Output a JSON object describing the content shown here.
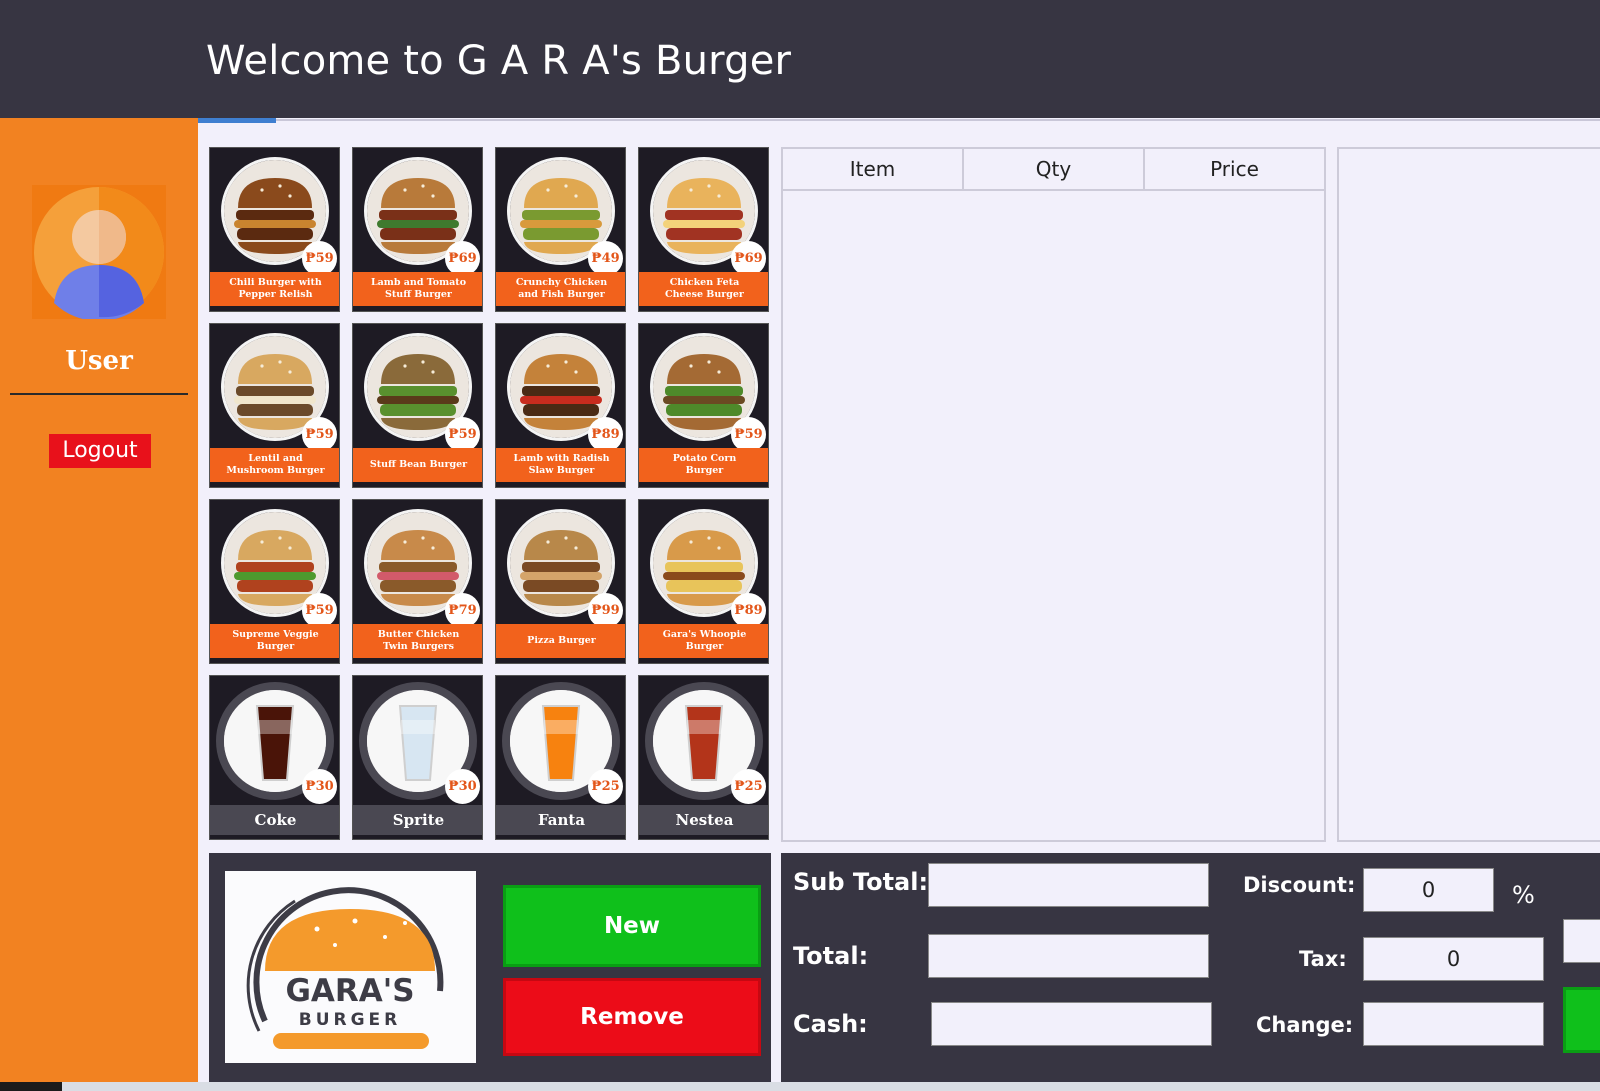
{
  "header": {
    "title": "Welcome to G A R A's Burger"
  },
  "sidebar": {
    "username": "User",
    "logout_label": "Logout"
  },
  "colors": {
    "header_bg": "#373542",
    "sidebar_bg": "#f28221",
    "label_orange": "#f2621c",
    "price_text": "#e3561a",
    "new_green": "#0fc01b",
    "remove_red": "#ec0c18",
    "logout_red": "#e8111b"
  },
  "menu": {
    "items": [
      {
        "name": "Chili Burger with Pepper Relish",
        "price": "₱59",
        "kind": "burger"
      },
      {
        "name": "Lamb and Tomato Stuff Burger",
        "price": "₱69",
        "kind": "burger"
      },
      {
        "name": "Crunchy Chicken and Fish Burger",
        "price": "₱49",
        "kind": "burger"
      },
      {
        "name": "Chicken Feta Cheese Burger",
        "price": "₱69",
        "kind": "burger"
      },
      {
        "name": "Lentil and Mushroom Burger",
        "price": "₱59",
        "kind": "burger"
      },
      {
        "name": "Stuff Bean Burger",
        "price": "₱59",
        "kind": "burger"
      },
      {
        "name": "Lamb with Radish Slaw Burger",
        "price": "₱89",
        "kind": "burger"
      },
      {
        "name": "Potato Corn Burger",
        "price": "₱59",
        "kind": "burger"
      },
      {
        "name": "Supreme Veggie Burger",
        "price": "₱59",
        "kind": "burger"
      },
      {
        "name": "Butter Chicken Twin Burgers",
        "price": "₱79",
        "kind": "burger"
      },
      {
        "name": "Pizza Burger",
        "price": "₱99",
        "kind": "burger"
      },
      {
        "name": "Gara's Whoopie Burger",
        "price": "₱89",
        "kind": "burger"
      },
      {
        "name": "Coke",
        "price": "₱30",
        "kind": "drink",
        "drink_color": "#4a1408"
      },
      {
        "name": "Sprite",
        "price": "₱30",
        "kind": "drink",
        "drink_color": "#d7e6f2"
      },
      {
        "name": "Fanta",
        "price": "₱25",
        "kind": "drink",
        "drink_color": "#f7820f"
      },
      {
        "name": "Nestea",
        "price": "₱25",
        "kind": "drink",
        "drink_color": "#b3341a"
      }
    ]
  },
  "order_table": {
    "columns": [
      "Item",
      "Qty",
      "Price"
    ],
    "rows": []
  },
  "actions": {
    "new_label": "New",
    "remove_label": "Remove"
  },
  "logo": {
    "line1": "GARA'S",
    "line2": "BURGER"
  },
  "totals": {
    "sub_total_label": "Sub Total:",
    "total_label": "Total:",
    "cash_label": "Cash:",
    "discount_label": "Discount:",
    "tax_label": "Tax:",
    "change_label": "Change:",
    "discount_value": "0",
    "discount_unit": "%",
    "tax_value": "0",
    "sub_total_value": "",
    "total_value": "",
    "cash_value": "",
    "change_value": ""
  }
}
